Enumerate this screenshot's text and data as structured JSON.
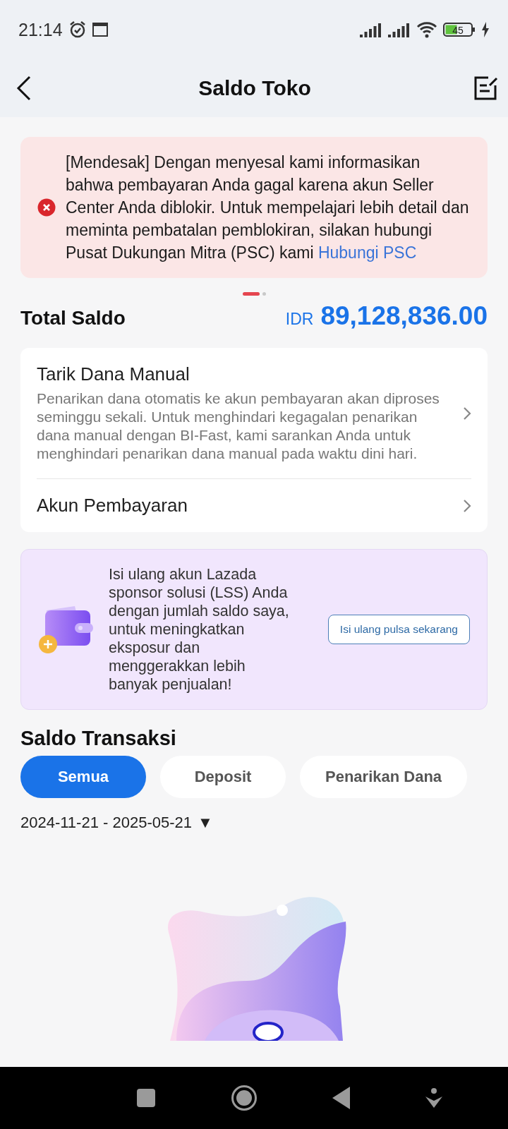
{
  "status_bar": {
    "time": "21:14",
    "battery": "45"
  },
  "header": {
    "title": "Saldo Toko"
  },
  "alert": {
    "message": "[Mendesak] Dengan menyesal kami informasikan bahwa pembayaran Anda gagal karena akun Seller Center Anda diblokir. Untuk mempelajari lebih detail dan meminta pembatalan pemblokiran, silakan hubungi Pusat Dukungan Mitra (PSC) kami",
    "link": "Hubungi PSC"
  },
  "pager": [
    {
      "selected": true
    },
    {
      "selected": false
    }
  ],
  "balance": {
    "label": "Total Saldo",
    "currency": "IDR",
    "amount": "89,128,836.00"
  },
  "menu": [
    {
      "title": "Tarik Dana Manual",
      "description": "Penarikan dana otomatis ke akun pembayaran akan diproses seminggu sekali. Untuk menghindari kegagalan penarikan dana manual dengan BI-Fast, kami sarankan Anda untuk menghindari penarikan dana manual pada waktu dini hari."
    },
    {
      "title": "Akun Pembayaran"
    }
  ],
  "promo": {
    "text": "Isi ulang akun Lazada sponsor solusi (LSS) Anda dengan jumlah saldo saya, untuk meningkatkan eksposur dan menggerakkan lebih banyak penjualan!",
    "button": "Isi ulang pulsa sekarang"
  },
  "transactions": {
    "title": "Saldo Transaksi",
    "tabs": [
      {
        "label": "Semua",
        "selected": true
      },
      {
        "label": "Deposit",
        "selected": false
      },
      {
        "label": "Penarikan Dana",
        "selected": false
      }
    ],
    "date_range": "2024-11-21 - 2025-05-21",
    "dropdown": "▼"
  }
}
